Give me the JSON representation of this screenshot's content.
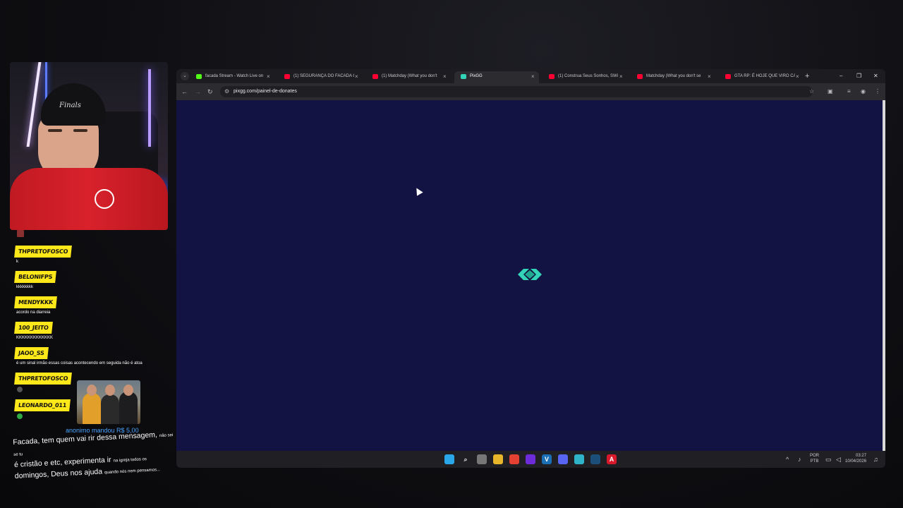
{
  "stream": {
    "webcam_cap_text": "Finals",
    "chat": [
      {
        "user": "THPRETOFOSCO",
        "message": "k",
        "emote": ""
      },
      {
        "user": "BELONIFPS",
        "message": "kkkkkkkk",
        "emote": ""
      },
      {
        "user": "MENDYKKK",
        "message": "acordo na diarreia",
        "emote": ""
      },
      {
        "user": "100_JEITO",
        "message": "KKKKKKKKKKKKK",
        "emote": ""
      },
      {
        "user": "JAOO_SS",
        "message": "é um sinal irmão essas coisas acontecendo em seguida não é atoa",
        "emote": ""
      },
      {
        "user": "THPRETOFOSCO",
        "message": "",
        "emote": "#555555"
      },
      {
        "user": "LEONARDO_011",
        "message": "",
        "emote": "#2faa44"
      }
    ],
    "donation": {
      "title": "anonimo mandou R$ 5,00",
      "message_main": "Facada, tem quem vai rir dessa mensagem,",
      "message_small_1": "não sei se tu",
      "message_mid": "é cristão e etc, experimenta ir",
      "message_small_2": "na igreja todos os",
      "message_end": "domingos, Deus nos ajuda",
      "message_small_3": "quando nós nem pensamos..."
    }
  },
  "browser": {
    "tabs": [
      {
        "title": "facada Stream - Watch Live on",
        "icon_color": "#53fc18",
        "active": false
      },
      {
        "title": "(1) SEGURANÇA DO FACADA C",
        "icon_color": "#ff0033",
        "active": false
      },
      {
        "title": "(1) Matchday (What you don't",
        "icon_color": "#ff0033",
        "active": false
      },
      {
        "title": "PixGG",
        "icon_color": "#32d3b6",
        "active": true
      },
      {
        "title": "(1) Construa Seus Sonhos, SWi",
        "icon_color": "#ff0033",
        "active": false
      },
      {
        "title": "Matchday (What you don't se",
        "icon_color": "#ff0033",
        "active": false
      },
      {
        "title": "GTA RP: É HOJE QUE VIRO CAI",
        "icon_color": "#ff0033",
        "active": false
      }
    ],
    "new_tab": "+",
    "window_controls": {
      "minimize": "–",
      "restore": "❐",
      "close": "✕"
    },
    "nav": {
      "back": "←",
      "forward": "→",
      "reload": "↻"
    },
    "url": "pixgg.com/painel-de-donates",
    "accent_loader_color": "#32d3b6",
    "page_background": "#121243"
  },
  "taskbar": {
    "apps": [
      {
        "name": "windows-start",
        "glyph": "",
        "color": "#2aa7e8"
      },
      {
        "name": "search",
        "glyph": "⌕",
        "color": "transparent"
      },
      {
        "name": "task-view",
        "glyph": "",
        "color": "#777777"
      },
      {
        "name": "file-explorer",
        "glyph": "",
        "color": "#e8b62a"
      },
      {
        "name": "chrome",
        "glyph": "",
        "color": "#e44133"
      },
      {
        "name": "app-purple",
        "glyph": "",
        "color": "#6e2bd9"
      },
      {
        "name": "vscode",
        "glyph": "V",
        "color": "#1a6fb5"
      },
      {
        "name": "discord",
        "glyph": "",
        "color": "#5865f2"
      },
      {
        "name": "notes",
        "glyph": "",
        "color": "#2fb3c8"
      },
      {
        "name": "steam",
        "glyph": "",
        "color": "#1b4f7a"
      },
      {
        "name": "adobe",
        "glyph": "A",
        "color": "#d8192b"
      }
    ],
    "tray": {
      "lang_top": "POR",
      "lang_bottom": "PTB",
      "time": "03:27",
      "date": "10/04/2026"
    }
  }
}
